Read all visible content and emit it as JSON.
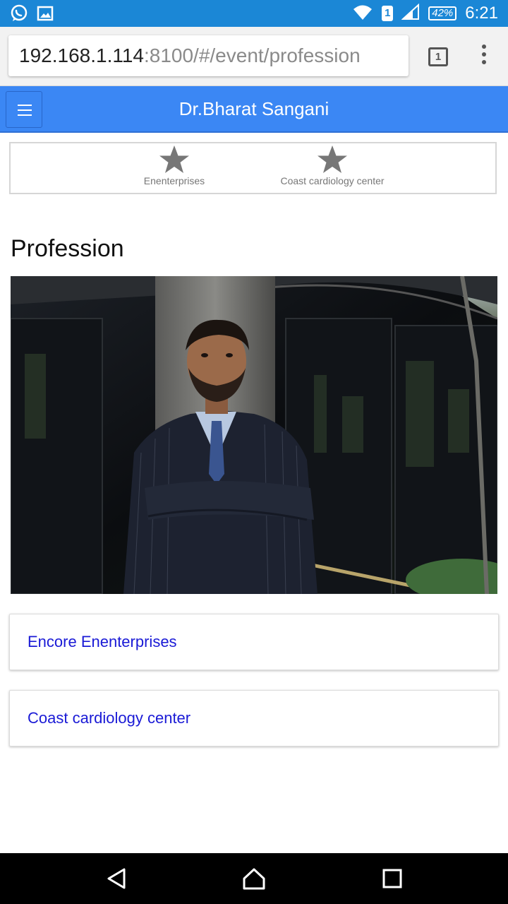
{
  "status_bar": {
    "time": "6:21",
    "battery": "42%",
    "sim_slot": "1",
    "icons": [
      "whatsapp-icon",
      "image-icon",
      "wifi-icon",
      "sim-icon",
      "signal-icon",
      "battery-icon"
    ]
  },
  "browser": {
    "url_host": "192.168.1.114",
    "url_path": ":8100/#/event/profession",
    "tab_count": "1"
  },
  "header": {
    "title": "Dr.Bharat Sangani",
    "accent": "#3b87f4"
  },
  "tabs": [
    {
      "label": "Enenterprises",
      "icon": "star-icon"
    },
    {
      "label": "Coast cardiology center",
      "icon": "star-icon"
    }
  ],
  "main": {
    "title": "Profession",
    "list": [
      {
        "label": "Encore Enenterprises"
      },
      {
        "label": "Coast cardiology center"
      }
    ]
  },
  "colors": {
    "status_bar": "#1b87d6",
    "link": "#1a1ad6"
  }
}
